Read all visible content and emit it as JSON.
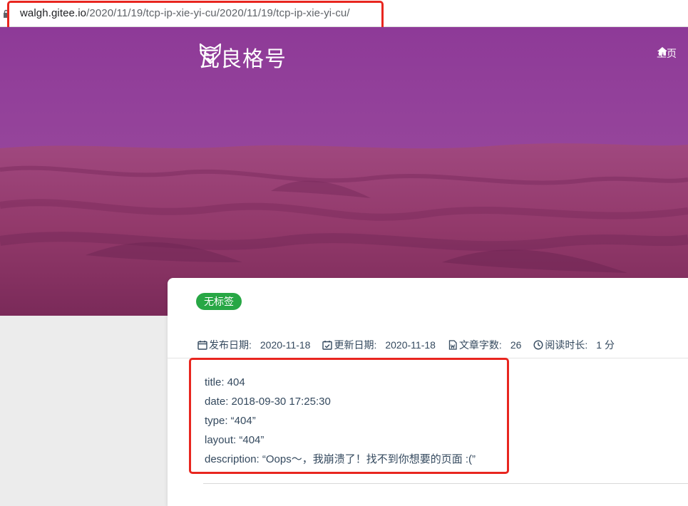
{
  "address_bar": {
    "url_host": "walgh.gitee.io",
    "url_path": "/2020/11/19/tcp-ip-xie-yi-cu/2020/11/19/tcp-ip-xie-yi-cu/"
  },
  "header": {
    "site_title": "瓦良格号",
    "logo_icon": "fox-icon",
    "nav": [
      {
        "label": "主页",
        "icon": "home-icon"
      }
    ]
  },
  "post": {
    "tag": "无标签",
    "meta": [
      {
        "label": "发布日期:",
        "value": "2020-11-18",
        "icon": "calendar-icon"
      },
      {
        "label": "更新日期:",
        "value": "2020-11-18",
        "icon": "calendar-check-icon"
      },
      {
        "label": "文章字数:",
        "value": "26",
        "icon": "file-word-icon"
      },
      {
        "label": "阅读时长:",
        "value": "1 分",
        "icon": "clock-icon"
      }
    ],
    "content_lines": [
      "title: 404",
      "date: 2018-09-30 17:25:30",
      "type: “404”",
      "layout: “404”",
      "description: “Oops～，我崩溃了！找不到你想要的页面 :(”"
    ]
  },
  "colors": {
    "banner_overlay": "#8f3a96",
    "tag_green": "#28a745",
    "highlight_red": "#e8261f",
    "text": "#34495e"
  }
}
